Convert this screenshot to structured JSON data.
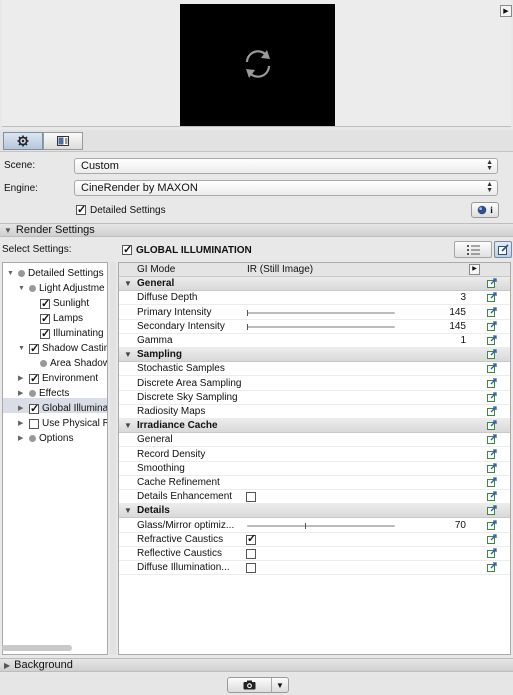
{
  "tabs": [
    {
      "icon": "gear-icon",
      "active": true
    },
    {
      "icon": "layout-icon",
      "active": false
    }
  ],
  "scene": {
    "label": "Scene:",
    "value": "Custom"
  },
  "engine": {
    "label": "Engine:",
    "value": "CineRender by MAXON"
  },
  "detailed_settings": {
    "label": "Detailed Settings",
    "checked": true
  },
  "render_settings_header": "Render Settings",
  "select_settings_label": "Select Settings:",
  "tree": [
    {
      "label": "Detailed Settings",
      "indent": 0,
      "arrow": "down",
      "kind": "dot"
    },
    {
      "label": "Light Adjustme",
      "indent": 1,
      "arrow": "down",
      "kind": "dot"
    },
    {
      "label": "Sunlight",
      "indent": 2,
      "arrow": "",
      "kind": "check",
      "checked": true
    },
    {
      "label": "Lamps",
      "indent": 2,
      "arrow": "",
      "kind": "check",
      "checked": true
    },
    {
      "label": "Illuminating S",
      "indent": 2,
      "arrow": "",
      "kind": "check",
      "checked": true
    },
    {
      "label": "Shadow Casting",
      "indent": 1,
      "arrow": "down",
      "kind": "check",
      "checked": true
    },
    {
      "label": "Area Shadow",
      "indent": 2,
      "arrow": "",
      "kind": "dot"
    },
    {
      "label": "Environment",
      "indent": 1,
      "arrow": "right",
      "kind": "check",
      "checked": true
    },
    {
      "label": "Effects",
      "indent": 1,
      "arrow": "right",
      "kind": "dot"
    },
    {
      "label": "Global Illuminat",
      "indent": 1,
      "arrow": "right",
      "kind": "check",
      "checked": true
    },
    {
      "label": "Use Physical Re",
      "indent": 1,
      "arrow": "right",
      "kind": "check",
      "checked": false
    },
    {
      "label": "Options",
      "indent": 1,
      "arrow": "right",
      "kind": "dot"
    }
  ],
  "panel": {
    "title": "GLOBAL ILLUMINATION",
    "checked": true
  },
  "gi_mode": {
    "label": "GI Mode",
    "value": "IR (Still Image)"
  },
  "groups": [
    {
      "title": "General",
      "rows": [
        {
          "label": "Diffuse Depth",
          "type": "number",
          "value": "3"
        },
        {
          "label": "Primary Intensity",
          "type": "slider",
          "value": "145",
          "fraction": 0.0
        },
        {
          "label": "Secondary Intensity",
          "type": "slider",
          "value": "145",
          "fraction": 0.0
        },
        {
          "label": "Gamma",
          "type": "number",
          "value": "1"
        }
      ]
    },
    {
      "title": "Sampling",
      "rows": [
        {
          "label": "Stochastic Samples",
          "type": "link"
        },
        {
          "label": "Discrete Area Sampling",
          "type": "link"
        },
        {
          "label": "Discrete Sky Sampling",
          "type": "link"
        },
        {
          "label": "Radiosity Maps",
          "type": "link"
        }
      ]
    },
    {
      "title": "Irradiance Cache",
      "rows": [
        {
          "label": "General",
          "type": "link"
        },
        {
          "label": "Record Density",
          "type": "link"
        },
        {
          "label": "Smoothing",
          "type": "link"
        },
        {
          "label": "Cache Refinement",
          "type": "link"
        },
        {
          "label": "Details Enhancement",
          "type": "checkbox",
          "checked": false
        }
      ]
    },
    {
      "title": "Details",
      "rows": [
        {
          "label": "Glass/Mirror optimiz...",
          "type": "slider",
          "value": "70",
          "fraction": 0.39
        },
        {
          "label": "Refractive Caustics",
          "type": "checkbox",
          "checked": true
        },
        {
          "label": "Reflective Caustics",
          "type": "checkbox",
          "checked": false
        },
        {
          "label": "Diffuse Illumination...",
          "type": "checkbox",
          "checked": false
        }
      ]
    }
  ],
  "background_header": "Background"
}
